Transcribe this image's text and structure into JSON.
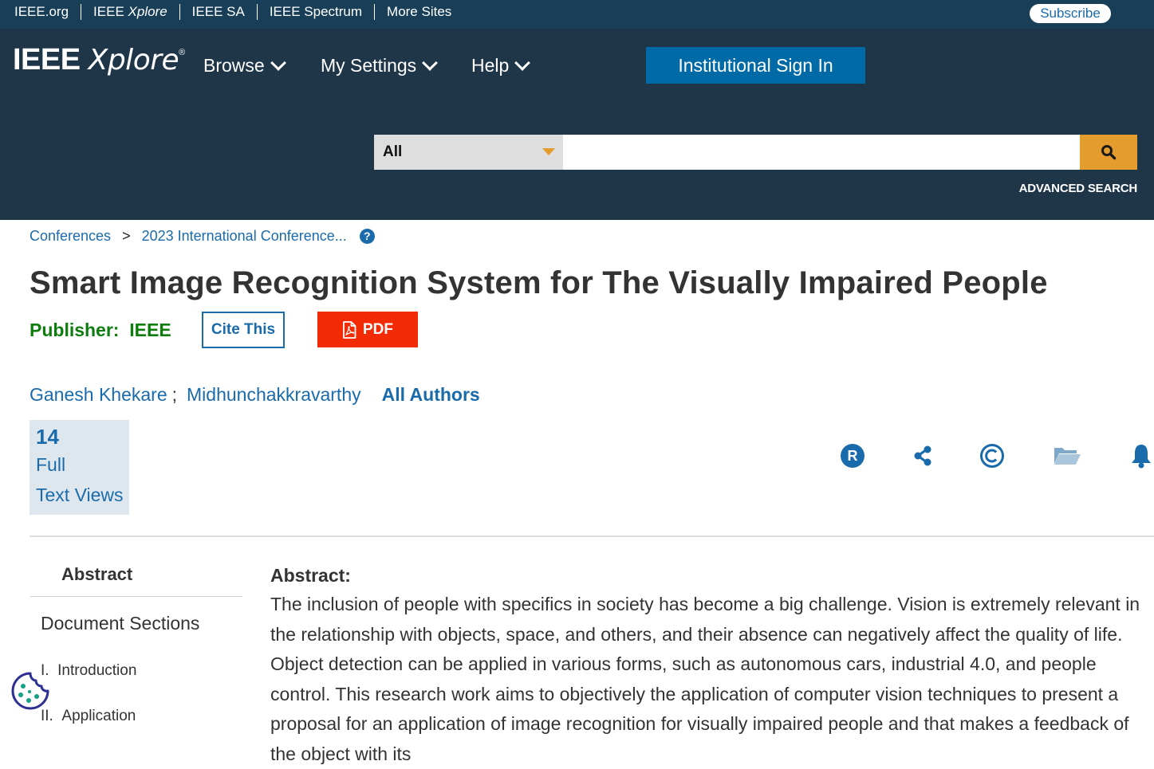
{
  "topbar": {
    "sites": [
      {
        "label": "IEEE.org"
      },
      {
        "label_prefix": "IEEE",
        "label_italic": "Xplore"
      },
      {
        "label": "IEEE SA"
      },
      {
        "label": "IEEE Spectrum"
      },
      {
        "label": "More Sites"
      }
    ],
    "subscribe": "Subscribe"
  },
  "header": {
    "logo_ieee": "IEEE",
    "logo_xplore": "Xplore",
    "logo_reg": "®",
    "nav": [
      "Browse",
      "My Settings",
      "Help"
    ],
    "signin": "Institutional Sign In",
    "search": {
      "scope": "All",
      "placeholder": "",
      "value": ""
    },
    "advanced": "ADVANCED SEARCH"
  },
  "breadcrumb": {
    "items": [
      "Conferences",
      "2023 International Conference..."
    ],
    "separator": ">",
    "help": "?"
  },
  "article": {
    "title": "Smart Image Recognition System for The Visually Impaired People",
    "publisher_label": "Publisher:",
    "publisher": "IEEE",
    "cite": "Cite This",
    "pdf": "PDF",
    "authors": [
      "Ganesh Khekare",
      "Midhunchakkravarthy"
    ],
    "author_sep": ";",
    "all_authors": "All Authors",
    "views": {
      "count": "14",
      "line1": "Full",
      "line2": "Text Views"
    }
  },
  "actions": [
    "rights-icon",
    "share-icon",
    "copyright-icon",
    "folder-icon",
    "bell-icon"
  ],
  "sidebar": {
    "abstract": "Abstract",
    "doc_sections": "Document Sections",
    "sections": [
      {
        "num": "I.",
        "label": "Introduction"
      },
      {
        "num": "II.",
        "label": "Application"
      }
    ]
  },
  "abstract": {
    "heading": "Abstract:",
    "text": "The inclusion of people with specifics in society has become a big challenge. Vision is extremely relevant in the relationship with objects, space, and others, and their absence can negatively affect the quality of life. Object detection can be applied in various forms, such as autonomous cars, industrial 4.0, and people control. This research work aims to objectively the application of computer vision techniques to present a proposal for an application of image recognition for visually impaired people and that makes a feedback of the object with its"
  },
  "colors": {
    "topbar": "#183f57",
    "header": "#1f3649",
    "link": "#1a6bab",
    "search_button": "#e49d2d",
    "pdf": "#f32b05",
    "publisher": "#0e7d0e",
    "cookie": "#16a085"
  }
}
